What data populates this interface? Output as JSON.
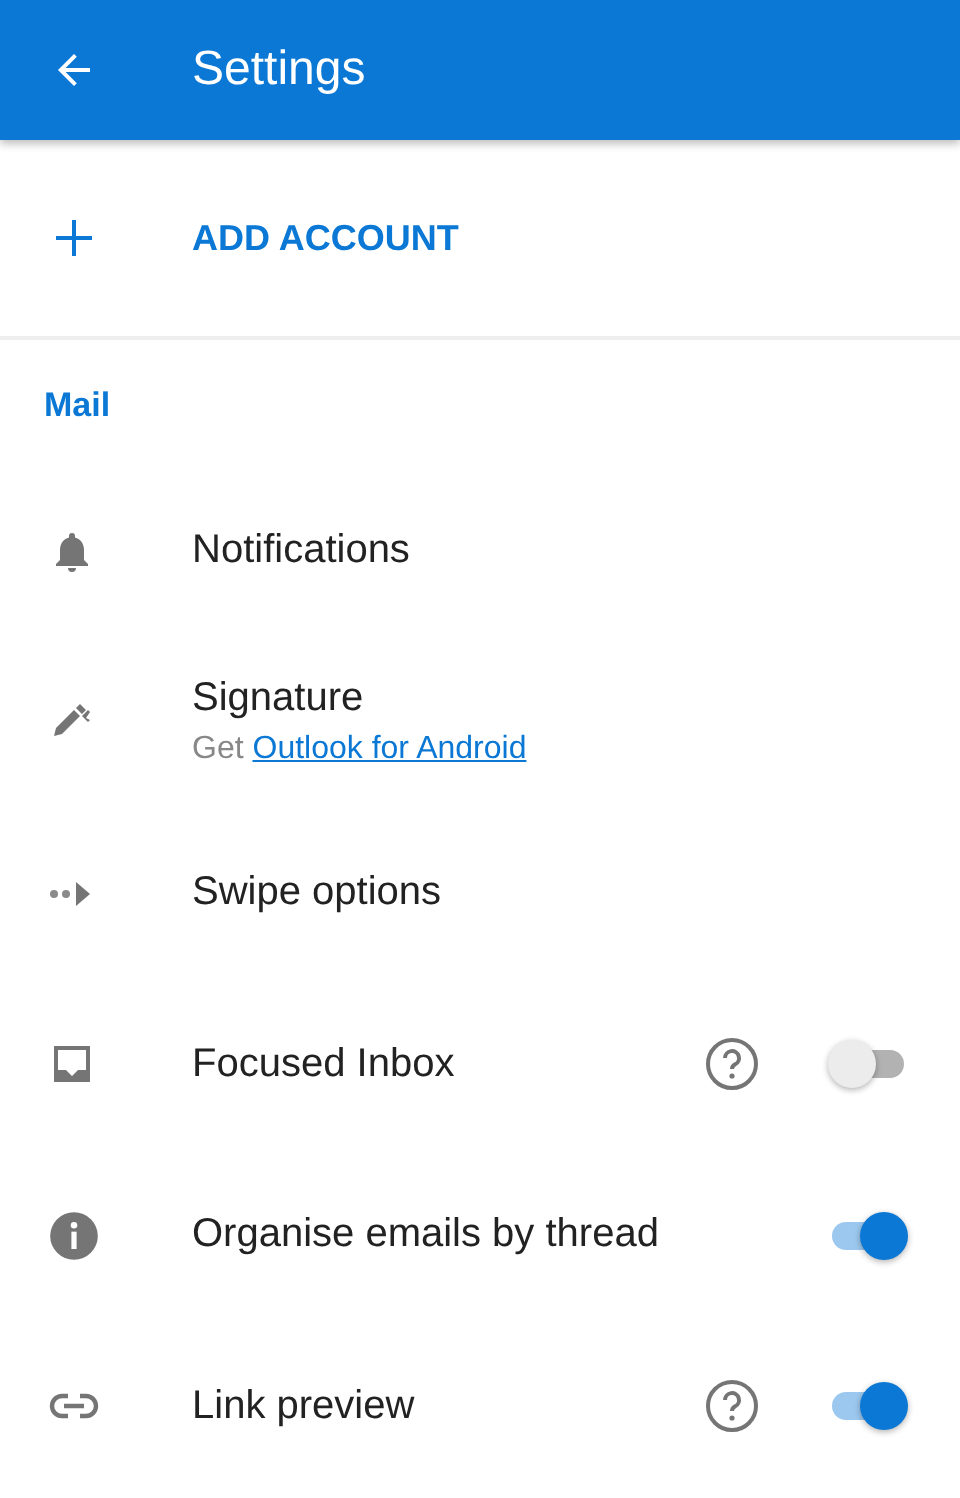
{
  "app_bar": {
    "title": "Settings"
  },
  "add_account": {
    "label": "ADD ACCOUNT"
  },
  "section": {
    "title": "Mail"
  },
  "items": [
    {
      "kind": "plain",
      "label": "Notifications"
    },
    {
      "kind": "subtitle",
      "label": "Signature",
      "subtitle": "Get",
      "link": "Outlook for Android"
    },
    {
      "kind": "plain",
      "label": "Swipe options"
    },
    {
      "kind": "toggle",
      "label": "Focused Inbox",
      "help": true,
      "on": false
    },
    {
      "kind": "toggle",
      "label": "Organise emails by thread",
      "help": false,
      "on": true
    },
    {
      "kind": "toggle",
      "label": "Link preview",
      "help": true,
      "on": true
    }
  ]
}
